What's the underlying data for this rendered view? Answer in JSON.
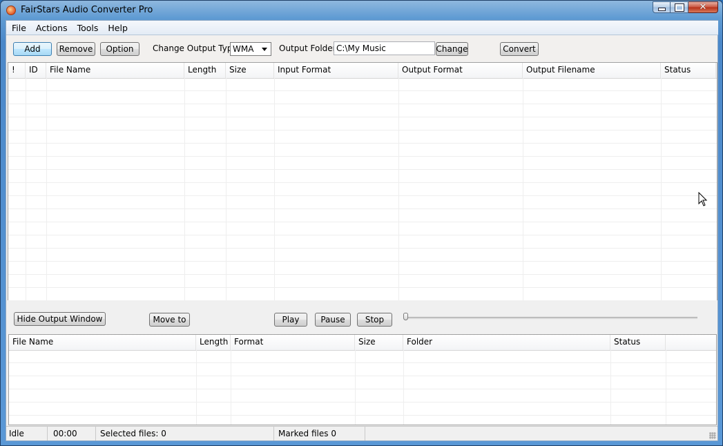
{
  "window": {
    "title": "FairStars Audio Converter Pro"
  },
  "menu": [
    "File",
    "Actions",
    "Tools",
    "Help"
  ],
  "toolbar": {
    "add": "Add",
    "remove": "Remove",
    "option": "Option",
    "output_type_label": "Change Output Type:",
    "output_type_value": "WMA",
    "output_folder_label": "Output Folder:",
    "output_folder_value": "C:\\My Music",
    "change": "Change",
    "convert": "Convert"
  },
  "input_grid": {
    "columns": [
      "!",
      "ID",
      "File Name",
      "Length",
      "Size",
      "Input Format",
      "Output Format",
      "Output Filename",
      "Status"
    ]
  },
  "controls": {
    "hide_output": "Hide Output Window",
    "move_to": "Move to",
    "play": "Play",
    "pause": "Pause",
    "stop": "Stop",
    "seek_position": 0
  },
  "output_grid": {
    "columns": [
      "File Name",
      "Length",
      "Format",
      "Size",
      "Folder",
      "Status"
    ]
  },
  "status": {
    "state": "Idle",
    "time": "00:00",
    "selected": "Selected files: 0",
    "marked": "Marked files 0"
  }
}
